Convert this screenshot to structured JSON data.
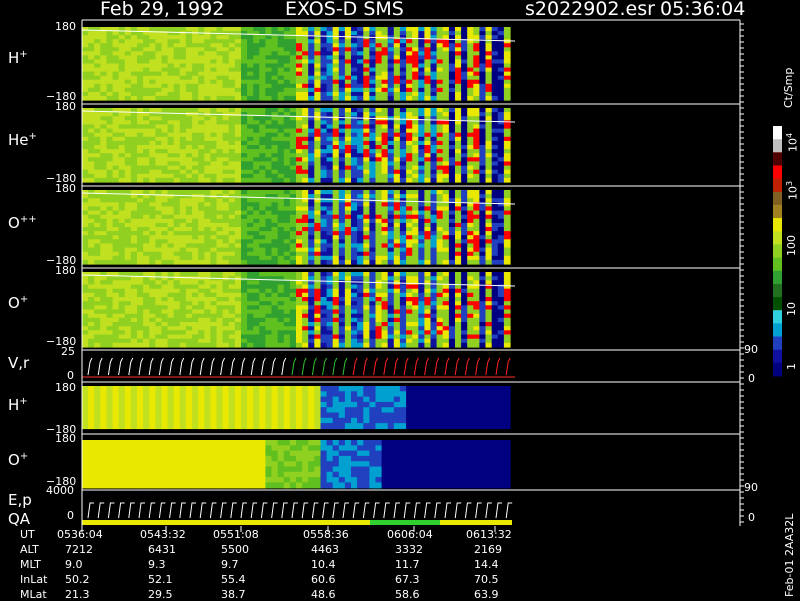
{
  "header": {
    "date": "Feb 29, 1992",
    "mission": "EXOS-D SMS",
    "file": "s2022902.esr",
    "time": "05:36:04"
  },
  "panels": [
    {
      "id": "h_plus",
      "label": "H",
      "sup": "+",
      "top": "180",
      "bottom": "−180"
    },
    {
      "id": "he_plus",
      "label": "He",
      "sup": "+",
      "top": "180",
      "bottom": "−180"
    },
    {
      "id": "o_pp",
      "label": "O",
      "sup": "++",
      "top": "180",
      "bottom": "−180"
    },
    {
      "id": "o_plus",
      "label": "O",
      "sup": "+",
      "top": "180",
      "bottom": "−180"
    },
    {
      "id": "vr",
      "label": "V,r",
      "top": "25",
      "bottom": "0",
      "right_top": "90",
      "right_bottom": "0"
    },
    {
      "id": "h_plus2",
      "label": "H",
      "sup": "+",
      "top": "180",
      "bottom": "−180"
    },
    {
      "id": "o_plus2",
      "label": "O",
      "sup": "+",
      "top": "180",
      "bottom": "−180"
    },
    {
      "id": "ep",
      "label": "E,p",
      "label2": "QA",
      "top": "4000",
      "bottom": "0",
      "right_top": "90",
      "right_bottom": "0"
    }
  ],
  "colorbar": {
    "unit": "Ct/Smp",
    "ticks": [
      {
        "base": "10",
        "exp": "4"
      },
      {
        "base": "10",
        "exp": "3"
      },
      {
        "base": "100",
        "exp": ""
      },
      {
        "base": "10",
        "exp": ""
      },
      {
        "base": "1",
        "exp": ""
      }
    ],
    "colors": [
      "#000080",
      "#1010a0",
      "#2040c0",
      "#00a0d0",
      "#30d0e0",
      "#005000",
      "#207020",
      "#30a030",
      "#60c020",
      "#90d020",
      "#c0e020",
      "#e8e800",
      "#a08020",
      "#806020",
      "#c02000",
      "#ff0000",
      "#500000",
      "#c0c0c0",
      "#ffffff"
    ]
  },
  "time_table": {
    "rows": [
      {
        "name": "UT",
        "values": [
          "0536:04",
          "0543:32",
          "0551:08",
          "0558:36",
          "0606:04",
          "0613:32"
        ]
      },
      {
        "name": "ALT",
        "values": [
          "7212",
          "6431",
          "5500",
          "4463",
          "3332",
          "2169"
        ]
      },
      {
        "name": "MLT",
        "values": [
          "9.0",
          "9.3",
          "9.7",
          "10.4",
          "11.7",
          "14.4"
        ]
      },
      {
        "name": "InLat",
        "values": [
          "50.2",
          "52.1",
          "55.4",
          "60.6",
          "67.3",
          "70.5"
        ]
      },
      {
        "name": "MLat",
        "values": [
          "21.3",
          "29.5",
          "38.7",
          "48.6",
          "58.6",
          "63.9"
        ]
      }
    ]
  },
  "side_note": "Feb-01 2AA32L",
  "chart_data": {
    "type": "heatmap",
    "title": "Feb 29, 1992   EXOS-D SMS",
    "xlabel": "UT",
    "x_ticks": [
      "0536:04",
      "0543:32",
      "0551:08",
      "0558:36",
      "0606:04",
      "0613:32"
    ],
    "ylim_pitch": [
      -180,
      180
    ],
    "colorbar_range": [
      1,
      10000
    ],
    "colorbar_scale": "log",
    "series": [
      "H+",
      "He+",
      "O++",
      "O+",
      "V,r",
      "H+",
      "O+",
      "E,p QA"
    ]
  }
}
